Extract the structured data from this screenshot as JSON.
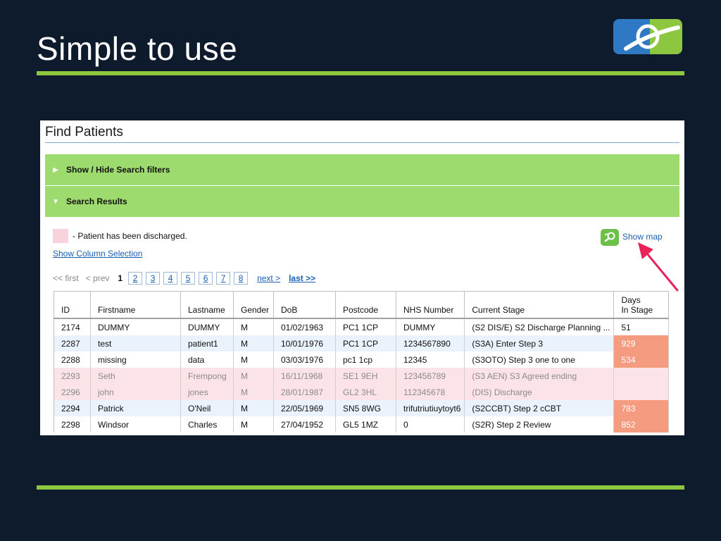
{
  "slide": {
    "title": "Simple to use"
  },
  "colors": {
    "background": "#0e1b2c",
    "accent_green": "#8dc63f",
    "bar_green": "#9edb6f",
    "discharged_pink": "#fbe3e8",
    "days_highlight": "#f59b7f",
    "arrow": "#e8235a"
  },
  "panel": {
    "title": "Find Patients",
    "filters_bar_label": "Show / Hide Search filters",
    "results_bar_label": "Search Results",
    "legend_text": "- Patient has been discharged.",
    "show_columns_link": "Show Column Selection",
    "show_map_link": "Show map",
    "show_map_icon": "map-icon"
  },
  "pager": {
    "first": "<< first",
    "prev": "< prev",
    "current": "1",
    "pages": [
      "2",
      "3",
      "4",
      "5",
      "6",
      "7",
      "8"
    ],
    "next": "next >",
    "last": "last >>"
  },
  "table": {
    "headers": [
      "ID",
      "Firstname",
      "Lastname",
      "Gender",
      "DoB",
      "Postcode",
      "NHS Number",
      "Current Stage",
      "Days",
      "In Stage"
    ],
    "rows": [
      {
        "id": "2174",
        "first": "DUMMY",
        "last": "DUMMY",
        "gender": "M",
        "dob": "01/02/1963",
        "postcode": "PC1 1CP",
        "nhs": "DUMMY",
        "stage": "(S2 DIS/E) S2 Discharge Planning ...",
        "days": "51"
      },
      {
        "id": "2287",
        "first": "test",
        "last": "patient1",
        "gender": "M",
        "dob": "10/01/1976",
        "postcode": "PC1 1CP",
        "nhs": "1234567890",
        "stage": "(S3A) Enter Step 3",
        "days": "929"
      },
      {
        "id": "2288",
        "first": "missing",
        "last": "data",
        "gender": "M",
        "dob": "03/03/1976",
        "postcode": "pc1 1cp",
        "nhs": "12345",
        "stage": "(S3OTO) Step 3 one to one",
        "days": "534"
      },
      {
        "id": "2293",
        "first": "Seth",
        "last": "Frempong",
        "gender": "M",
        "dob": "16/11/1968",
        "postcode": "SE1 9EH",
        "nhs": "123456789",
        "stage": "(S3 AEN) S3 Agreed ending",
        "days": ""
      },
      {
        "id": "2296",
        "first": "john",
        "last": "jones",
        "gender": "M",
        "dob": "28/01/1987",
        "postcode": "GL2 3HL",
        "nhs": "112345678",
        "stage": "(DIS) Discharge",
        "days": ""
      },
      {
        "id": "2294",
        "first": "Patrick",
        "last": "O'Neil",
        "gender": "M",
        "dob": "22/05/1969",
        "postcode": "SN5 8WG",
        "nhs": "trifutriutiuytoyt6",
        "stage": "(S2CCBT) Step 2 cCBT",
        "days": "783"
      },
      {
        "id": "2298",
        "first": "Windsor",
        "last": "Charles",
        "gender": "M",
        "dob": "27/04/1952",
        "postcode": "GL5 1MZ",
        "nhs": "0",
        "stage": "(S2R) Step 2 Review",
        "days": "852"
      }
    ]
  }
}
